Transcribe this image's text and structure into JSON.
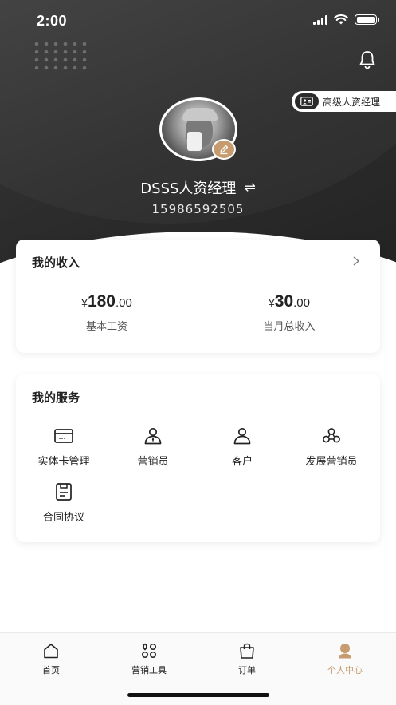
{
  "status_bar": {
    "time": "2:00"
  },
  "profile": {
    "role_badge": "高级人资经理",
    "username": "DSSS人资经理",
    "switch_symbol": "⇌",
    "phone": "15986592505"
  },
  "income": {
    "title": "我的收入",
    "items": [
      {
        "currency": "¥",
        "integer": "180",
        "decimal": ".00",
        "label": "基本工资"
      },
      {
        "currency": "¥",
        "integer": "30",
        "decimal": ".00",
        "label": "当月总收入"
      }
    ]
  },
  "services": {
    "title": "我的服务",
    "items": [
      {
        "label": "实体卡管理",
        "icon": "card-icon"
      },
      {
        "label": "营销员",
        "icon": "salesperson-icon"
      },
      {
        "label": "客户",
        "icon": "customer-icon"
      },
      {
        "label": "发展营销员",
        "icon": "team-icon"
      },
      {
        "label": "合同协议",
        "icon": "contract-icon"
      }
    ]
  },
  "tabbar": {
    "items": [
      {
        "label": "首页",
        "icon": "home-icon"
      },
      {
        "label": "营销工具",
        "icon": "tools-icon"
      },
      {
        "label": "订单",
        "icon": "bag-icon"
      },
      {
        "label": "个人中心",
        "icon": "profile-icon",
        "active": true
      }
    ]
  },
  "colors": {
    "accent": "#c69b6d",
    "header_dark": "#2d2d2d"
  }
}
